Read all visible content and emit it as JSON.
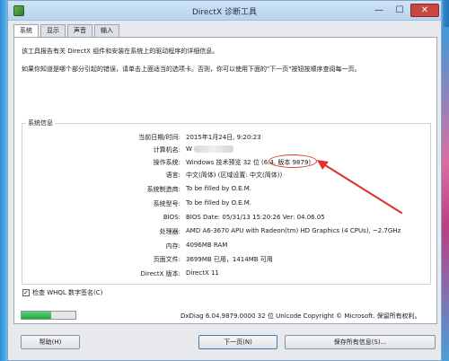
{
  "window": {
    "title": "DirectX 诊断工具",
    "close_glyph": "✕",
    "min_glyph": "—",
    "max_glyph": "☐"
  },
  "tabs": [
    {
      "label": "系统",
      "active": true
    },
    {
      "label": "显示",
      "active": false
    },
    {
      "label": "声音",
      "active": false
    },
    {
      "label": "输入",
      "active": false
    }
  ],
  "intro": {
    "line1": "该工具报告有关 DirectX 组件和安装在系统上的驱动程序的详细信息。",
    "line2": "如果你知道是哪个部分引起的错误，请单击上面适当的选项卡。否则，你可以使用下面的\"下一页\"按钮按顺序查阅每一页。"
  },
  "system_info": {
    "group_title": "系统信息",
    "rows": [
      {
        "label": "当前日期/时间:",
        "value": "2015年1月24日, 9:20:23"
      },
      {
        "label": "计算机名:",
        "value": "W"
      },
      {
        "label": "操作系统:",
        "value": "Windows 技术预览 32 位 (6.4, 版本 9879)"
      },
      {
        "label": "语言:",
        "value": "中文(简体) (区域设置: 中文(简体))"
      },
      {
        "label": "系统制造商:",
        "value": "To be filled by O.E.M."
      },
      {
        "label": "系统型号:",
        "value": "To be filled by O.E.M."
      },
      {
        "label": "BIOS:",
        "value": "BIOS Date: 05/31/13 15:20:26 Ver: 04.06.05"
      },
      {
        "label": "处理器:",
        "value": "AMD A6-3670 APU with Radeon(tm) HD Graphics (4 CPUs), ~2.7GHz"
      },
      {
        "label": "内存:",
        "value": "4096MB RAM"
      },
      {
        "label": "页面文件:",
        "value": "3699MB 已用，1414MB 可用"
      },
      {
        "label": "DirectX 版本:",
        "value": "DirectX 11"
      }
    ]
  },
  "whql_checkbox": {
    "label": "检查 WHQL 数字签名(C)",
    "checked": true,
    "glyph": "✓"
  },
  "progress": {
    "fraction": 0.55
  },
  "copyright": "DxDiag 6.04.9879.0000 32 位 Unicode  Copyright © Microsoft. 保留所有权利。",
  "buttons": {
    "help": "帮助(H)",
    "next": "下一页(N)",
    "save": "保存所有信息(S)..."
  },
  "colors": {
    "annotation": "#e0342b",
    "progress": "#1faa3d"
  }
}
